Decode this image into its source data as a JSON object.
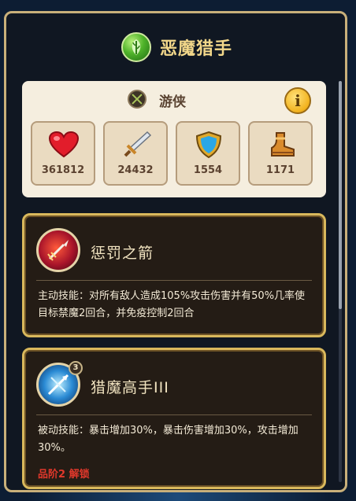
{
  "header": {
    "title": "恶魔猎手",
    "logo_icon": "leaf-emblem-icon"
  },
  "class_card": {
    "class_icon": "crossed-arrows-icon",
    "class_name": "游侠",
    "info_label": "i",
    "stats": [
      {
        "icon": "heart-icon",
        "value": "361812"
      },
      {
        "icon": "sword-icon",
        "value": "24432"
      },
      {
        "icon": "shield-icon",
        "value": "1554"
      },
      {
        "icon": "boot-icon",
        "value": "1171"
      }
    ]
  },
  "skills": [
    {
      "icon": "flaming-arrow-icon",
      "name": "惩罚之箭",
      "description": "主动技能：对所有敌人造成105%攻击伤害并有50%几率使目标禁魔2回合，并免疫控制2回合",
      "level": "",
      "unlock": ""
    },
    {
      "icon": "ice-crossbow-icon",
      "name": "猎魔高手III",
      "level": "3",
      "description": "被动技能：暴击增加30%，暴击伤害增加30%，攻击增加30%。",
      "unlock": "品阶2 解锁"
    }
  ],
  "colors": {
    "accent_gold": "#d9b85c",
    "unlock_red": "#e0382b",
    "title_gold": "#f2d78a"
  }
}
